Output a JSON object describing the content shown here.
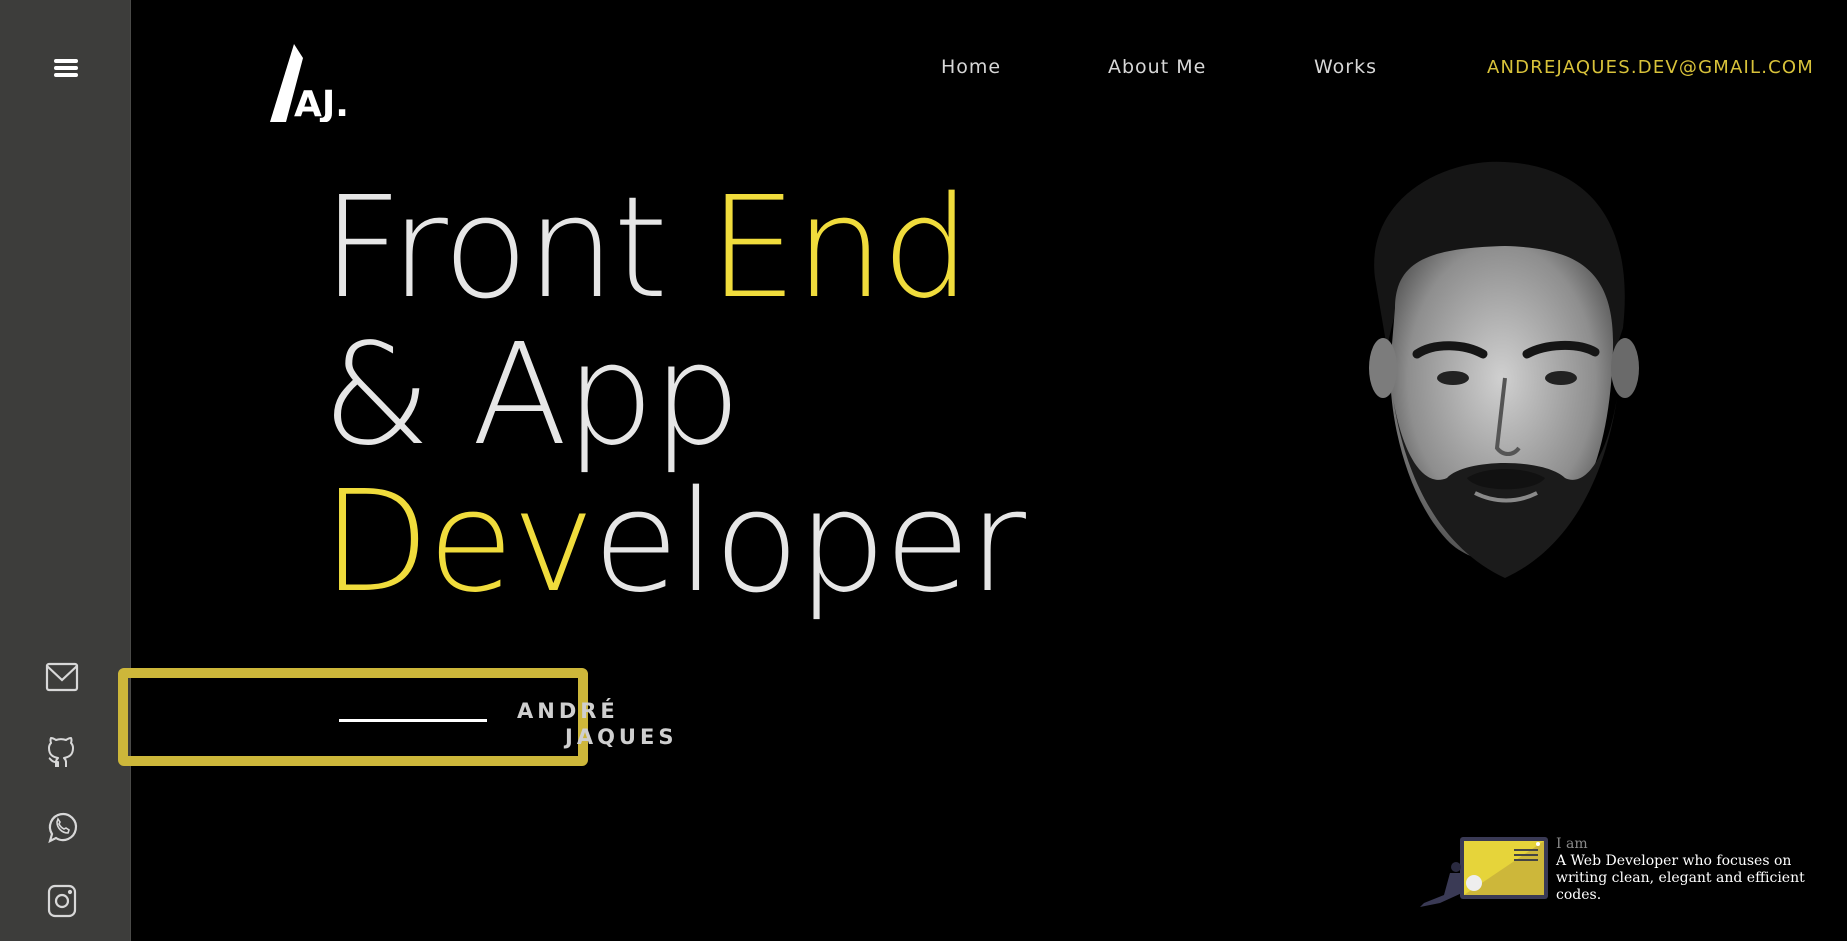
{
  "header": {
    "logo_text": "AJ.",
    "nav": [
      {
        "label": "Home"
      },
      {
        "label": "About Me"
      },
      {
        "label": "Works"
      }
    ],
    "email": "ANDREJAQUES.DEV@GMAIL.COM"
  },
  "sidebar": {
    "menu_icon": "hamburger-icon",
    "socials": [
      "mail-icon",
      "github-icon",
      "whatsapp-icon",
      "instagram-icon"
    ]
  },
  "hero": {
    "line1_a": "Front ",
    "line1_b": "End",
    "line2": "& App",
    "line3_a": "Dev",
    "line3_b": "eloper",
    "name_first": "ANDRÉ",
    "name_last": "JAQUES"
  },
  "intro_card": {
    "label": "I am",
    "text": "A Web Developer who focuses on writing clean, elegant and efficient codes."
  },
  "colors": {
    "accent": "#f0dc3c",
    "frame": "#cdb73a",
    "sidebar": "#3d3d3b",
    "background": "#000000"
  }
}
